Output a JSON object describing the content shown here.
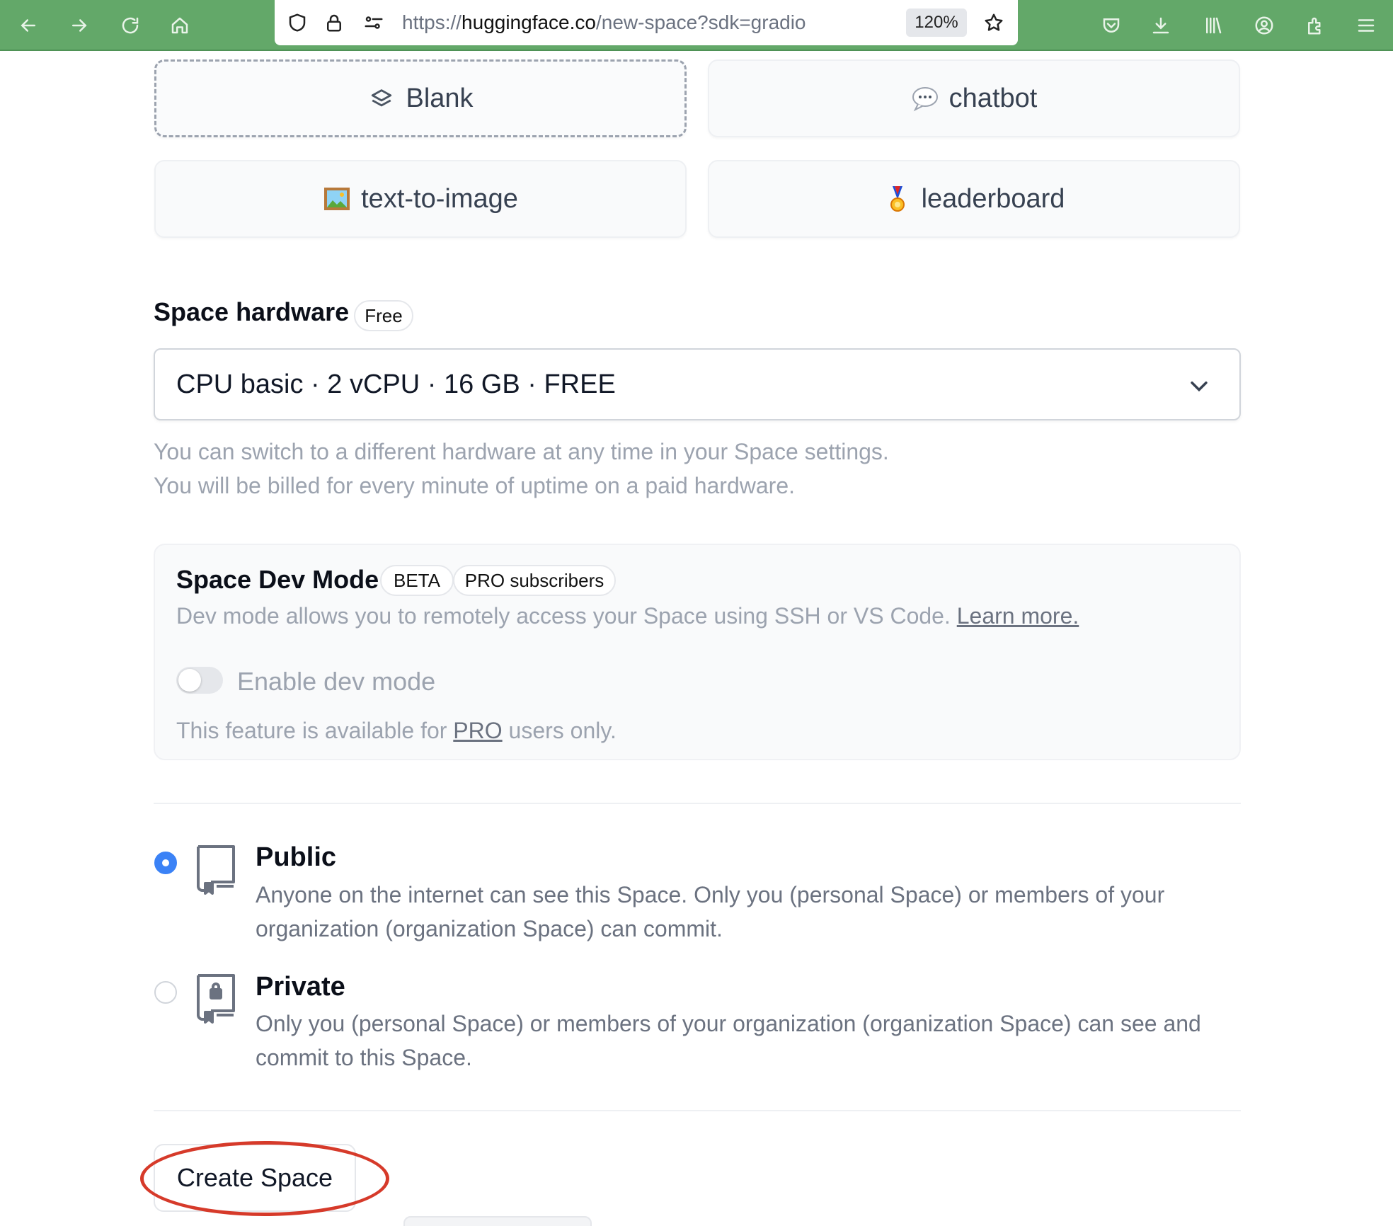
{
  "browser": {
    "url_scheme": "https://",
    "url_host": "huggingface.co",
    "url_path": "/new-space?sdk=gradio",
    "zoom": "120%",
    "toolbar_color": "#63a869"
  },
  "templates": [
    {
      "label": "Blank",
      "icon": "layers-icon"
    },
    {
      "label": "chatbot",
      "icon": "speech-bubble-icon"
    },
    {
      "label": "text-to-image",
      "icon": "framed-picture-icon"
    },
    {
      "label": "leaderboard",
      "icon": "medal-icon"
    }
  ],
  "hardware": {
    "title": "Space hardware",
    "badge": "Free",
    "selected": "CPU basic · 2 vCPU · 16 GB · FREE",
    "help_line1": "You can switch to a different hardware at any time in your Space settings.",
    "help_line2": "You will be billed for every minute of uptime on a paid hardware."
  },
  "dev_mode": {
    "title": "Space Dev Mode",
    "badge_beta": "BETA",
    "badge_pro": "PRO subscribers",
    "description": "Dev mode allows you to remotely access your Space using SSH or VS Code.",
    "learn_more": "Learn more.",
    "toggle_label": "Enable dev mode",
    "toggle_on": false,
    "note_prefix": "This feature is available for",
    "note_link": "PRO",
    "note_suffix": "users only."
  },
  "visibility": {
    "selected": "public",
    "public": {
      "title": "Public",
      "description": "Anyone on the internet can see this Space. Only you (personal Space) or members of your organization (organization Space) can commit."
    },
    "private": {
      "title": "Private",
      "description": "Only you (personal Space) or members of your organization (organization Space) can see and commit to this Space."
    }
  },
  "create_button": "Create Space",
  "annotation_color": "#d63a2a"
}
